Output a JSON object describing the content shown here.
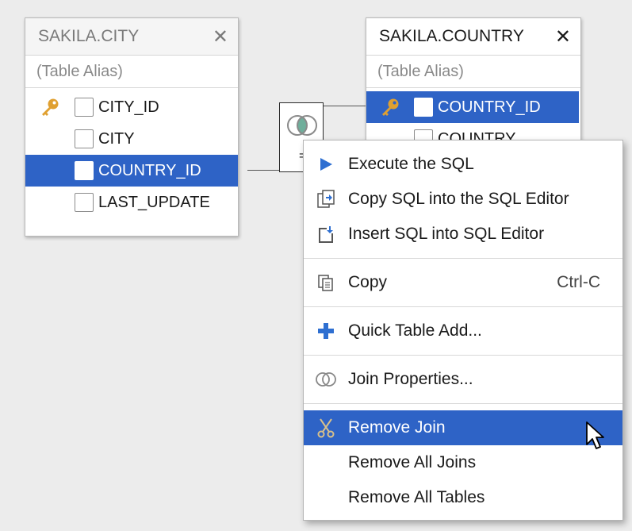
{
  "tables": [
    {
      "title": "SAKILA.CITY",
      "alias_placeholder": "(Table Alias)",
      "columns": [
        {
          "name": "CITY_ID",
          "key": true,
          "selected": false
        },
        {
          "name": "CITY",
          "key": false,
          "selected": false
        },
        {
          "name": "COUNTRY_ID",
          "key": false,
          "selected": true
        },
        {
          "name": "LAST_UPDATE",
          "key": false,
          "selected": false
        }
      ]
    },
    {
      "title": "SAKILA.COUNTRY",
      "alias_placeholder": "(Table Alias)",
      "columns": [
        {
          "name": "COUNTRY_ID",
          "key": true,
          "selected": true
        },
        {
          "name": "COUNTRY",
          "key": false,
          "selected": false
        }
      ]
    }
  ],
  "join": {
    "icon": "venn-join-icon",
    "operator": "="
  },
  "context_menu": {
    "execute": "Execute the SQL",
    "copy_sql": "Copy SQL into the SQL Editor",
    "insert_sql": "Insert SQL into SQL Editor",
    "copy": "Copy",
    "copy_shortcut": "Ctrl-C",
    "quick_add": "Quick Table Add...",
    "join_props": "Join Properties...",
    "remove_join": "Remove Join",
    "remove_all_joins": "Remove All Joins",
    "remove_all_tables": "Remove All Tables"
  },
  "colors": {
    "selection": "#2e63c6",
    "key": "#e0a030",
    "play": "#2e6fd1",
    "plus": "#2e6fd1",
    "join_ring": "#6fae9b"
  }
}
